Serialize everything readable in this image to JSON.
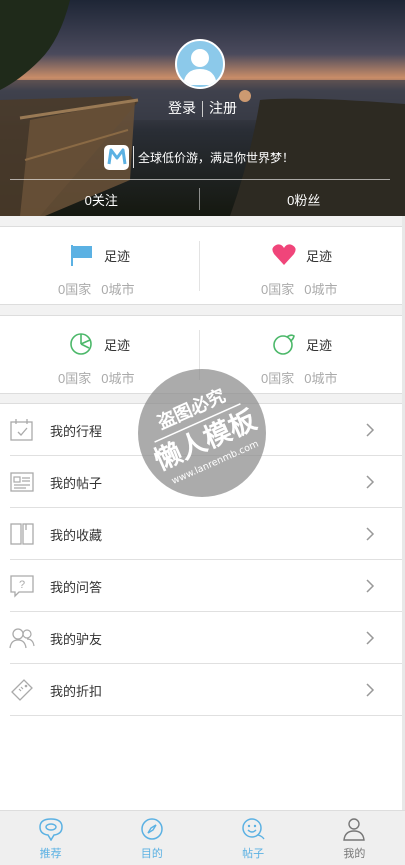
{
  "header": {
    "login": "登录",
    "register": "注册",
    "slogan": "全球低价游，满足你世界梦！",
    "logo_letter": "M",
    "follow": "0关注",
    "fans": "0粉丝"
  },
  "footprints": [
    {
      "title": "足迹",
      "country": "0国家",
      "city": "0城市",
      "icon": "flag-icon",
      "color": "#5bb1e3"
    },
    {
      "title": "足迹",
      "country": "0国家",
      "city": "0城市",
      "icon": "heart-icon",
      "color": "#f0457a"
    },
    {
      "title": "足迹",
      "country": "0国家",
      "city": "0城市",
      "icon": "pie-chart-icon",
      "color": "#4cb86a"
    },
    {
      "title": "足迹",
      "country": "0国家",
      "city": "0城市",
      "icon": "ball-icon",
      "color": "#4cb86a"
    }
  ],
  "menu": [
    {
      "label": "我的行程",
      "icon": "calendar-check-icon"
    },
    {
      "label": "我的帖子",
      "icon": "newspaper-icon"
    },
    {
      "label": "我的收藏",
      "icon": "book-icon"
    },
    {
      "label": "我的问答",
      "icon": "question-bubble-icon"
    },
    {
      "label": "我的驴友",
      "icon": "friends-icon"
    },
    {
      "label": "我的折扣",
      "icon": "ticket-icon"
    }
  ],
  "watermark": {
    "line1": "盗图必究",
    "line2": "懒人模板",
    "line3": "www.lanrenmb.com"
  },
  "tabs": [
    {
      "label": "推荐",
      "icon": "location-bubble-icon",
      "color": "#5bb1e3"
    },
    {
      "label": "目的",
      "icon": "compass-icon",
      "color": "#5bb1e3"
    },
    {
      "label": "帖子",
      "icon": "chat-smile-icon",
      "color": "#5bb1e3"
    },
    {
      "label": "我的",
      "icon": "user-icon",
      "color": "#777777"
    }
  ]
}
